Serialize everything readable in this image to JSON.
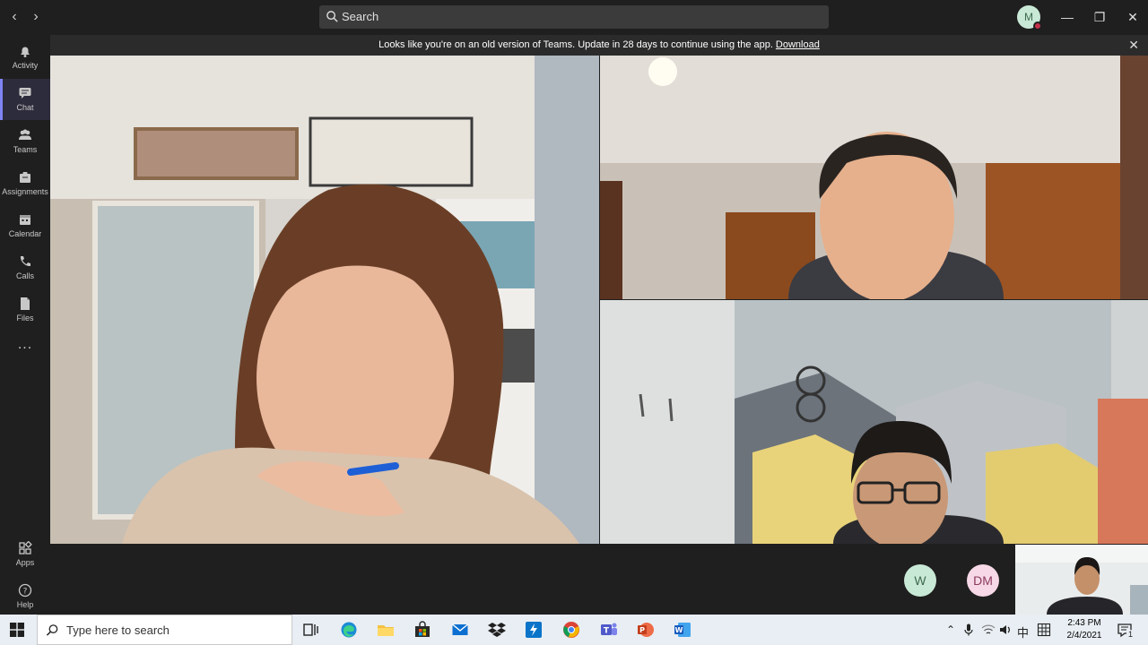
{
  "titlebar": {
    "search_placeholder": "Search",
    "user_initial": "M"
  },
  "rail": {
    "items": [
      {
        "label": "Activity"
      },
      {
        "label": "Chat"
      },
      {
        "label": "Teams"
      },
      {
        "label": "Assignments"
      },
      {
        "label": "Calendar"
      },
      {
        "label": "Calls"
      },
      {
        "label": "Files"
      },
      {
        "label": "..."
      }
    ],
    "apps_label": "Apps",
    "help_label": "Help"
  },
  "banner": {
    "message": "Looks like you're on an old version of Teams. Update in 28 days to continue using the app.",
    "link": "Download"
  },
  "participants": [
    {
      "initials": "W",
      "bg": "#c9e9d7",
      "fg": "#3d6b4f"
    },
    {
      "initials": "DM",
      "bg": "#f7d8e6",
      "fg": "#8b3a5e"
    }
  ],
  "taskbar": {
    "search_placeholder": "Type here to search",
    "time": "2:43 PM",
    "date": "2/4/2021",
    "ime": "中",
    "notification_count": "1"
  },
  "colors": {
    "accent": "#7f85f5",
    "background": "#1f1f1f",
    "banner": "#2b2b2b",
    "status_busy": "#c4314b"
  }
}
